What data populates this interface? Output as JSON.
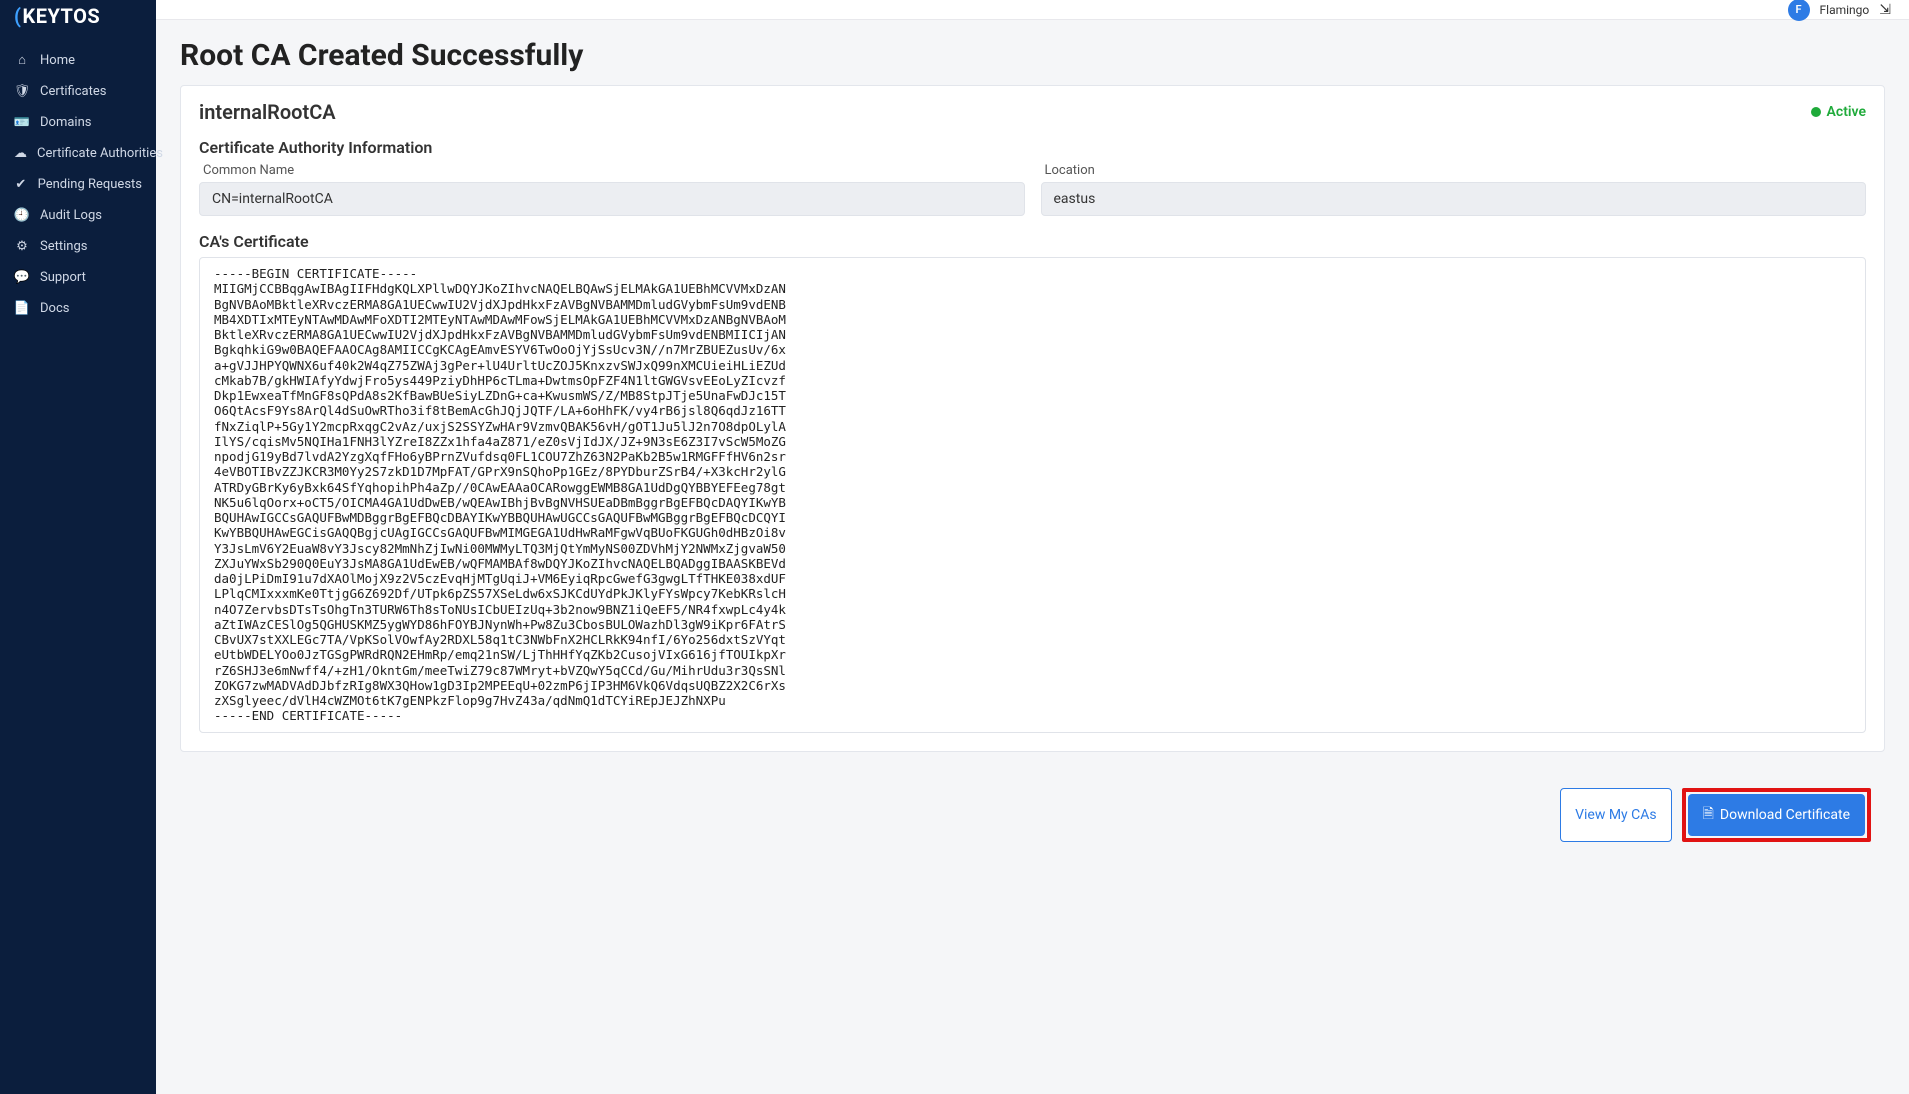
{
  "brand": {
    "name": "KEYTOS",
    "mark": "("
  },
  "user": {
    "avatar_initial": "F",
    "display_name": "Flamingo"
  },
  "sidebar": {
    "items": [
      {
        "label": "Home",
        "icon": "home"
      },
      {
        "label": "Certificates",
        "icon": "shield"
      },
      {
        "label": "Domains",
        "icon": "id"
      },
      {
        "label": "Certificate Authorities",
        "icon": "cloud"
      },
      {
        "label": "Pending Requests",
        "icon": "check"
      },
      {
        "label": "Audit Logs",
        "icon": "clock"
      },
      {
        "label": "Settings",
        "icon": "gear"
      },
      {
        "label": "Support",
        "icon": "chat"
      },
      {
        "label": "Docs",
        "icon": "doc"
      }
    ]
  },
  "page": {
    "title": "Root CA Created Successfully",
    "ca_name": "internalRootCA",
    "status": "Active"
  },
  "info": {
    "heading": "Certificate Authority Information",
    "common_name_label": "Common Name",
    "common_name_value": "CN=internalRootCA",
    "location_label": "Location",
    "location_value": "eastus"
  },
  "cert": {
    "heading": "CA's Certificate",
    "pem": "-----BEGIN CERTIFICATE-----\nMIIGMjCCBBqgAwIBAgIIFHdgKQLXPllwDQYJKoZIhvcNAQELBQAwSjELMAkGA1UEBhMCVVMxDzAN\nBgNVBAoMBktleXRvczERMA8GA1UECwwIU2VjdXJpdHkxFzAVBgNVBAMMDmludGVybmFsUm9vdENB\nMB4XDTIxMTEyNTAwMDAwMFoXDTI2MTEyNTAwMDAwMFowSjELMAkGA1UEBhMCVVMxDzANBgNVBAoM\nBktleXRvczERMA8GA1UECwwIU2VjdXJpdHkxFzAVBgNVBAMMDmludGVybmFsUm9vdENBMIICIjAN\nBgkqhkiG9w0BAQEFAAOCAg8AMIICCgKCAgEAmvESYV6TwOoOjYjSsUcv3N//n7MrZBUEZusUv/6x\na+gVJJHPYQWNX6uf40k2W4qZ75ZWAj3gPer+lU4UrltUcZOJ5KnxzvSWJxQ99nXMCUieiHLiEZUd\ncMkab7B/gkHWIAfyYdwjFro5ys449PziyDhHP6cTLma+DwtmsOpFZF4N1ltGWGVsvEEoLyZIcvzf\nDkp1EwxeaTfMnGF8sQPdA8s2KfBawBUeSiyLZDnG+ca+KwusmWS/Z/MB8StpJTje5UnaFwDJc15T\nO6QtAcsF9Ys8ArQl4dSuOwRTho3if8tBemAcGhJQjJQTF/LA+6oHhFK/vy4rB6jsl8Q6qdJz16TT\nfNxZiqlP+5Gy1Y2mcpRxqgC2vAz/uxjS2SSYZwHAr9VzmvQBAK56vH/gOT1Ju5lJ2n7O8dpOLylA\nIlYS/cqisMv5NQIHa1FNH3lYZreI8ZZx1hfa4aZ871/eZ0sVjIdJX/JZ+9N3sE6Z3I7vScW5MoZG\nnpodjG19yBd7lvdA2YzgXqfFHo6yBPrnZVufdsq0FL1COU7ZhZ63N2PaKb2B5w1RMGFFfHV6n2sr\n4eVBOTIBvZZJKCR3M0Yy2S7zkD1D7MpFAT/GPrX9nSQhoPp1GEz/8PYDburZSrB4/+X3kcHr2ylG\nATRDyGBrKy6yBxk64SfYqhopihPh4aZp//0CAwEAAaOCARowggEWMB8GA1UdDgQYBBYEFEeg78gt\nNK5u6lqOorx+oCT5/OICMA4GA1UdDwEB/wQEAwIBhjBvBgNVHSUEaDBmBggrBgEFBQcDAQYIKwYB\nBQUHAwIGCCsGAQUFBwMDBggrBgEFBQcDBAYIKwYBBQUHAwUGCCsGAQUFBwMGBggrBgEFBQcDCQYI\nKwYBBQUHAwEGCisGAQQBgjcUAgIGCCsGAQUFBwMIMGEGA1UdHwRaMFgwVqBUoFKGUGh0dHBzOi8v\nY3JsLmV6Y2EuaW8vY3Jscy82MmNhZjIwNi00MWMyLTQ3MjQtYmMyNS00ZDVhMjY2NWMxZjgvaW50\nZXJuYWxSb290Q0EuY3JsMA8GA1UdEwEB/wQFMAMBAf8wDQYJKoZIhvcNAQELBQADggIBAASKBEVd\nda0jLPiDmI91u7dXAOlMojX9z2V5czEvqHjMTgUqiJ+VM6EyiqRpcGwefG3gwgLTfTHKE038xdUF\nLPlqCMIxxxmKe0TtjgG6Z692Df/UTpk6pZS57XSeLdw6xSJKCdUYdPkJKlyFYsWpcy7KebKRslcH\nn4O7ZervbsDTsTsOhgTn3TURW6Th8sToNUsICbUEIzUq+3b2now9BNZ1iQeEF5/NR4fxwpLc4y4k\naZtIWAzCESlOg5QGHUSKMZ5ygWYD86hFOYBJNynWh+Pw8Zu3CbosBULOWazhDl3gW9iKpr6FAtrS\nCBvUX7stXXLEGc7TA/VpKSolVOwfAy2RDXL58q1tC3NWbFnX2HCLRkK94nfI/6Yo256dxtSzVYqt\neUtbWDELYOo0JzTGSgPWRdRQN2EHmRp/emq21nSW/LjThHHfYqZKb2CusojVIxG616jfTOUIkpXr\nrZ6SHJ3e6mNwff4/+zH1/OkntGm/meeTwiZ79c87WMryt+bVZQwY5qCCd/Gu/MihrUdu3r3QsSNl\nZOKG7zwMADVAdDJbfzRIg8WX3QHow1gD3Ip2MPEEqU+02zmP6jIP3HM6VkQ6VdqsUQBZ2X2C6rXs\nzXSglyeec/dVlH4cWZMOt6tK7gENPkzFlop9g7HvZ43a/qdNmQ1dTCYiREpJEJZhNXPu\n-----END CERTIFICATE-----"
  },
  "actions": {
    "view_cas": "View My CAs",
    "download_cert": "Download Certificate"
  },
  "icons": {
    "home": "⌂",
    "shield": "🛡",
    "id": "🪪",
    "cloud": "☁",
    "check": "✔",
    "clock": "🕘",
    "gear": "⚙",
    "chat": "💬",
    "doc": "📄",
    "logout": "⇲",
    "download": "🗎"
  }
}
